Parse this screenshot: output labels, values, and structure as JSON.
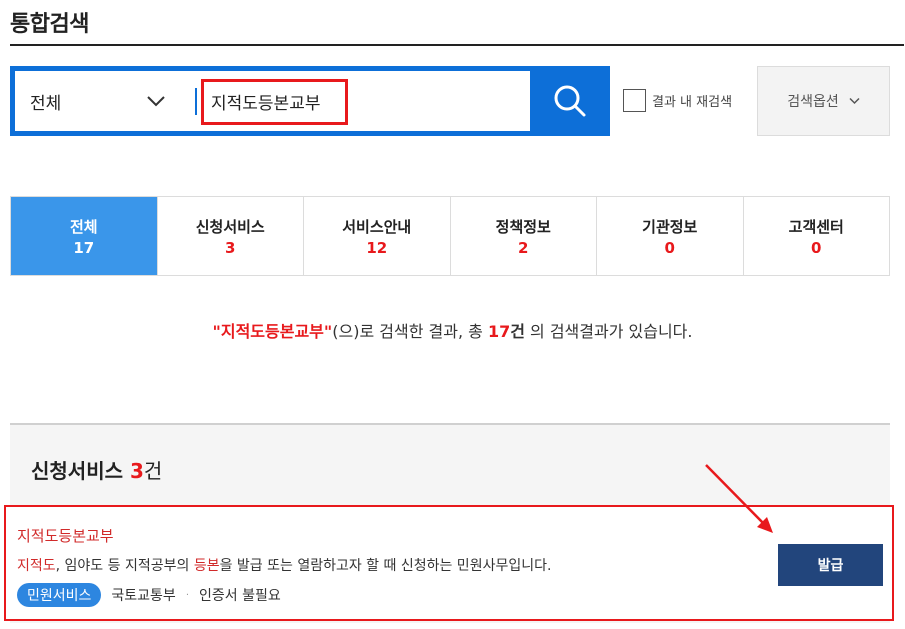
{
  "header": {
    "title": "통합검색"
  },
  "search": {
    "scope": "전체",
    "query": "지적도등본교부",
    "research_label": "결과 내 재검색",
    "options_label": "검색옵션"
  },
  "tabs": [
    {
      "label": "전체",
      "count": "17",
      "active": true
    },
    {
      "label": "신청서비스",
      "count": "3"
    },
    {
      "label": "서비스안내",
      "count": "12"
    },
    {
      "label": "정책정보",
      "count": "2"
    },
    {
      "label": "기관정보",
      "count": "0"
    },
    {
      "label": "고객센터",
      "count": "0"
    }
  ],
  "summary": {
    "open_quote": "\"",
    "query": "지적도등본교부",
    "close_quote": "\"",
    "text_1": "(으)로 검색한 결과, 총 ",
    "count": "17",
    "unit": "건",
    "text_2": " 의 검색결과가 있습니다."
  },
  "section": {
    "title": "신청서비스",
    "count": "3",
    "unit": "건"
  },
  "result": {
    "title": "지적도등본교부",
    "desc_hl_1": "지적도",
    "desc_1": ", 임야도 등 지적공부의 ",
    "desc_hl_2": "등본",
    "desc_2": "을 발급 또는 열람하고자 할 때 신청하는 민원사무입니다.",
    "badge": "민원서비스",
    "agency": "국토교통부",
    "separator": "·",
    "cert": "인증서 불필요",
    "action": "발급"
  },
  "colors": {
    "accent_blue": "#0d6fd8",
    "active_tab": "#3a96ea",
    "highlight_red": "#e8191c",
    "issue_button": "#22457c"
  },
  "icons": [
    "chevron-down-icon",
    "search-icon",
    "annotation-arrow"
  ]
}
